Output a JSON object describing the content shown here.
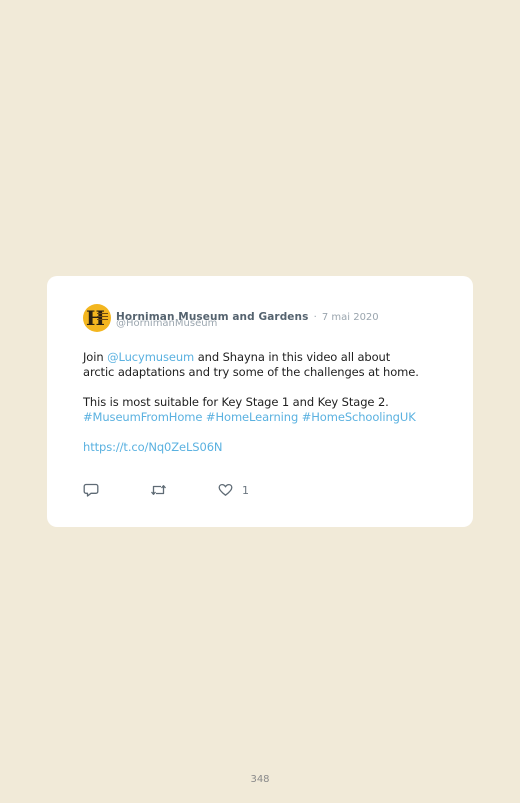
{
  "tweet": {
    "author_name": "Horniman Museum and Gardens",
    "separator": "·",
    "date": "7 mai 2020",
    "handle": "@HornimanMuseum",
    "line1_prefix": "Join ",
    "mention": "@Lucymuseum",
    "line1_suffix": " and Shayna in this video all about",
    "line2": "arctic adaptations and try some of the challenges at home.",
    "line3": "This is most suitable for Key Stage 1 and Key Stage 2.",
    "hashtags": [
      "#MuseumFromHome",
      "#HomeLearning",
      "#HomeSchoolingUK"
    ],
    "url": "https://t.co/Nq0ZeLS06N",
    "like_count": "1"
  },
  "icons": {
    "reply": "reply-icon",
    "retweet": "retweet-icon",
    "like": "heart-icon"
  },
  "colors": {
    "page_background": "#f1ead8",
    "card_background": "#ffffff",
    "link": "#5ab1e0",
    "avatar": "#f3b61f"
  },
  "page": {
    "number": "348"
  }
}
